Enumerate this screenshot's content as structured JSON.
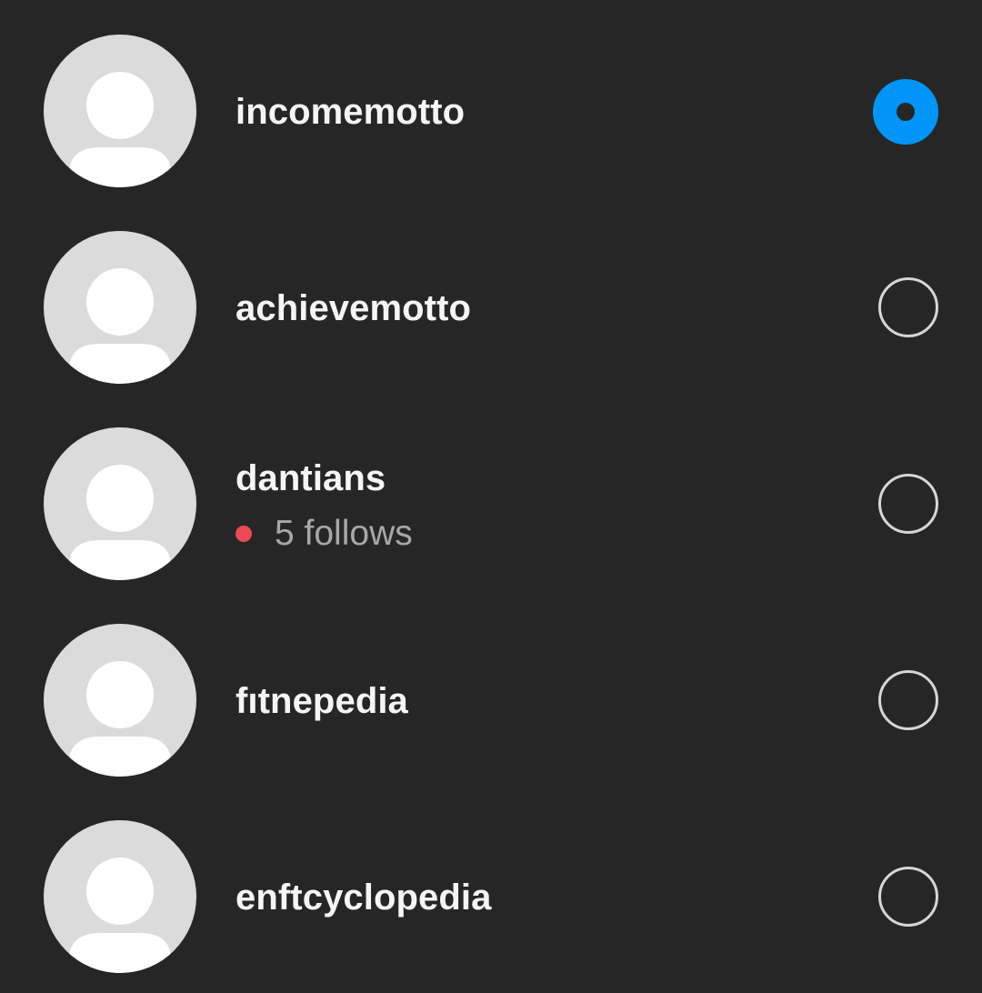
{
  "accounts": [
    {
      "username": "incomemotto",
      "selected": true,
      "subtitle": ""
    },
    {
      "username": "achievemotto",
      "selected": false,
      "subtitle": ""
    },
    {
      "username": "dantians",
      "selected": false,
      "subtitle": "5 follows",
      "has_notification_dot": true
    },
    {
      "username": "fıtnepedia",
      "selected": false,
      "subtitle": ""
    },
    {
      "username": "enftcyclopedia",
      "selected": false,
      "subtitle": ""
    }
  ],
  "colors": {
    "background": "#262626",
    "selected_radio": "#0095f6",
    "notification_dot": "#ed4956",
    "avatar_bg": "#dbdbdb"
  },
  "icons": {
    "avatar": "default-profile-silhouette-icon",
    "radio_selected": "radio-selected-icon",
    "radio_unselected": "radio-unselected-icon",
    "notification": "notification-dot-icon"
  }
}
